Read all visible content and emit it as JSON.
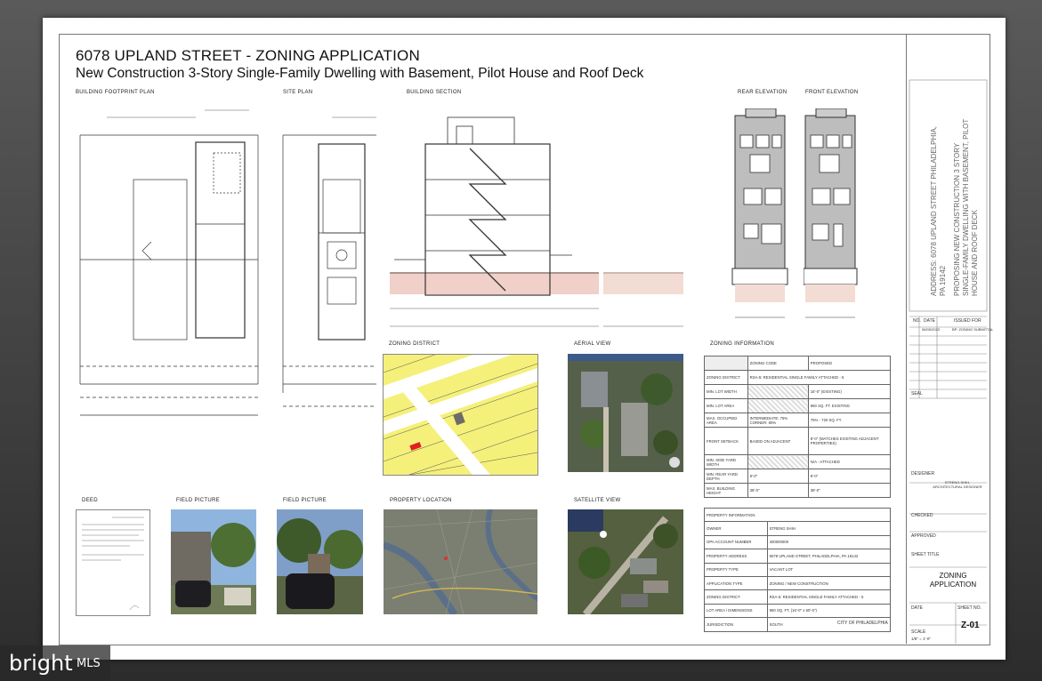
{
  "sheet": {
    "title": "6078 UPLAND STREET - ZONING APPLICATION",
    "subtitle": "New Construction 3-Story Single-Family Dwelling with Basement, Pilot House and Roof Deck"
  },
  "sections": {
    "footprint": "BUILDING FOOTPRINT PLAN",
    "site": "SITE PLAN",
    "section": "BUILDING SECTION",
    "rear": "REAR ELEVATION",
    "front": "FRONT ELEVATION",
    "zoning_district": "ZONING DISTRICT",
    "aerial": "AERIAL VIEW",
    "zoning_info": "ZONING INFORMATION",
    "deed": "DEED",
    "field1": "FIELD PICTURE",
    "field2": "FIELD PICTURE",
    "location": "PROPERTY LOCATION",
    "satellite": "SATELLITE VIEW"
  },
  "zoning_table": {
    "headers": [
      "",
      "ZONING CODE",
      "PROPOSED"
    ],
    "rows": [
      [
        "ZONING DISTRICT",
        "RSA-5: RESIDENTIAL SINGLE FAMILY ATTACHED - 5",
        ""
      ],
      [
        "MIN. LOT WIDTH",
        "",
        "16'-0\" (EXISTING)"
      ],
      [
        "MIN. LOT AREA",
        "",
        "960 SQ. FT. EXISTING"
      ],
      [
        "MAX. OCCUPIED AREA",
        "INTERMEDIATE: 75% CORNER: 80%",
        "75% - 720 SQ. FT."
      ],
      [
        "FRONT SETBACK",
        "BASED ON ADJACENT",
        "8'-0\" (MATCHES EXISTING ADJACENT PROPERTIES)"
      ],
      [
        "MIN. SIDE YARD WIDTH",
        "",
        "N/A - ATTACHED"
      ],
      [
        "MIN. REAR YARD DEPTH",
        "9'-0\"",
        "9'-0\""
      ],
      [
        "MAX. BUILDING HEIGHT",
        "38'-0\"",
        "38'-0\""
      ]
    ]
  },
  "property_table": {
    "title": "PROPERTY INFORMATION",
    "rows": [
      [
        "OWNER",
        "STRENG SHIH"
      ],
      [
        "OPA ACCOUNT NUMBER",
        "400000000"
      ],
      [
        "PROPERTY ADDRESS",
        "6078 UPLAND STREET, PHILADELPHIA, PA 19142"
      ],
      [
        "PROPERTY TYPE",
        "VACANT LOT"
      ],
      [
        "APPLICATION TYPE",
        "ZONING / NEW CONSTRUCTION"
      ],
      [
        "ZONING DISTRICT",
        "RSA-5: RESIDENTIAL SINGLE FAMILY ATTACHED - 5"
      ],
      [
        "LOT AREA / DIMENSIONS",
        "960 SQ. FT. (16'-0\" x 60'-0\")"
      ],
      [
        "JURISDICTION",
        "SOUTH"
      ]
    ]
  },
  "city": "CITY OF PHILADELPHIA",
  "title_block": {
    "address": "ADDRESS: 6078 UPLAND STREET PHILADELPHIA, PA 19142",
    "project": "PROPOSING NEW CONSTRUCTION 3 STORY SINGLE-FAMILY DWELLING WITH BASEMENT, PILOT HOUSE AND ROOF DECK",
    "no": "NO.",
    "date": "DATE",
    "issued": "ISSUED FOR",
    "rev_date": "06/05/2023",
    "rev_note": "BP: ZONING SUBMITTAL",
    "seal": "SEAL",
    "designer": "DESIGNER",
    "designer_name": "STRENG SHIH, ARCHITECTURAL DESIGNER",
    "checked": "CHECKED",
    "approved": "APPROVED",
    "sheet_title_label": "SHEET TITLE",
    "sheet_title": "ZONING APPLICATION",
    "date_label": "DATE",
    "sheet_no_label": "SHEET NO.",
    "scale_label": "SCALE",
    "scale": "1/8\" = 1'-0\"",
    "sheet_no": "Z-01"
  },
  "watermark": {
    "brand": "bright",
    "suffix": "MLS"
  }
}
